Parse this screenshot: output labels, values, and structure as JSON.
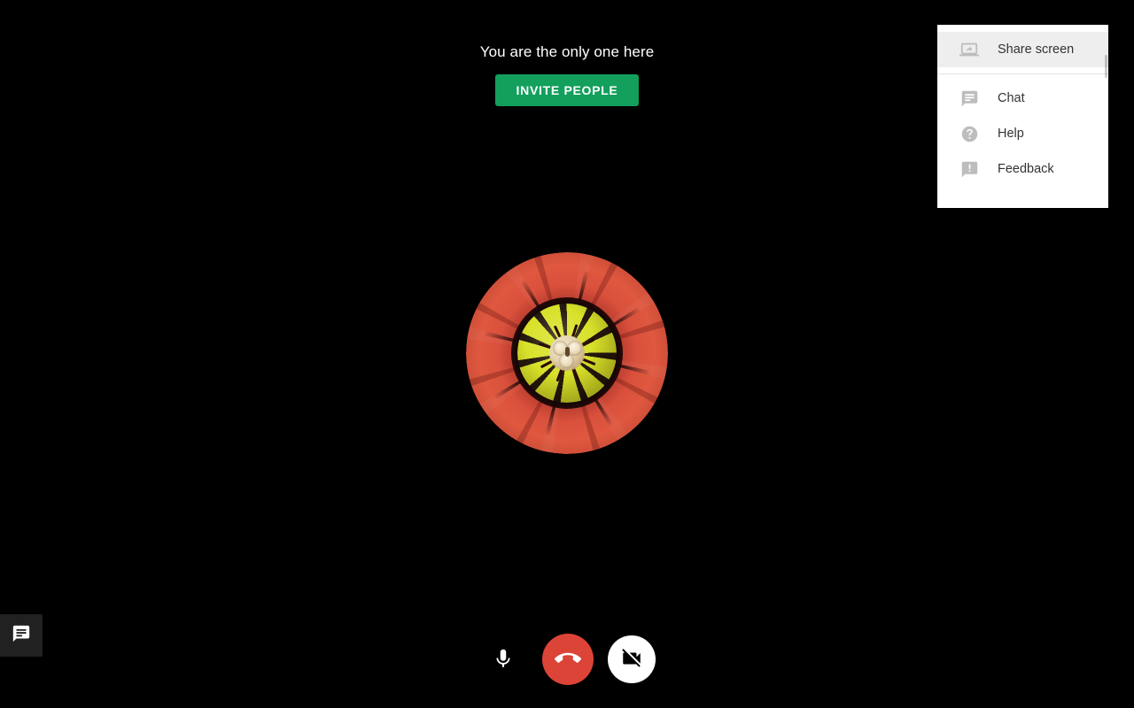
{
  "app": {
    "background_color": "#000000"
  },
  "status": {
    "message": "You are the only one here",
    "invite_button_label": "INVITE PEOPLE",
    "invite_button_color": "#12a05c"
  },
  "avatar": {
    "name": "participant-avatar",
    "description": "red flower photo"
  },
  "overflow_menu": {
    "visible": true,
    "background_color": "#ffffff",
    "highlight_color": "#eeeeee",
    "items": [
      {
        "label": "Share screen",
        "icon": "screen-share-icon",
        "highlighted": true
      },
      {
        "label": "Chat",
        "icon": "chat-icon",
        "highlighted": false
      },
      {
        "label": "Help",
        "icon": "help-icon",
        "highlighted": false
      },
      {
        "label": "Feedback",
        "icon": "feedback-icon",
        "highlighted": false
      }
    ]
  },
  "controls": {
    "mic": {
      "label": "Turn off microphone",
      "icon": "microphone-icon",
      "state": "on"
    },
    "hangup": {
      "label": "Leave call",
      "icon": "call-end-icon",
      "color": "#db4437"
    },
    "video": {
      "label": "Turn on camera",
      "icon": "videocam-off-icon",
      "state": "off",
      "color": "#ffffff"
    }
  },
  "chat_tab": {
    "label": "Chat",
    "icon": "chat-icon",
    "color": "#212121"
  }
}
